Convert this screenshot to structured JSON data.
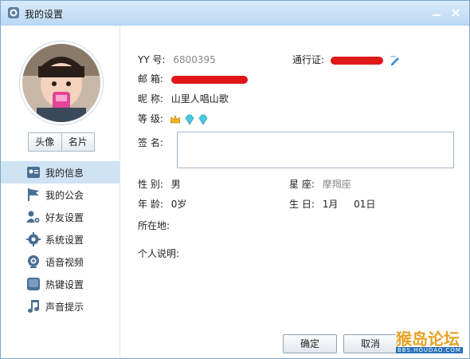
{
  "window": {
    "title": "我的设置"
  },
  "sidebar": {
    "avatar_buttons": [
      "头像",
      "名片"
    ],
    "items": [
      {
        "label": "我的信息",
        "icon": "profile-card-icon",
        "active": true
      },
      {
        "label": "我的公会",
        "icon": "flag-icon",
        "active": false
      },
      {
        "label": "好友设置",
        "icon": "friend-settings-icon",
        "active": false
      },
      {
        "label": "系统设置",
        "icon": "gear-icon",
        "active": false
      },
      {
        "label": "语音视频",
        "icon": "webcam-icon",
        "active": false
      },
      {
        "label": "热键设置",
        "icon": "hotkey-icon",
        "active": false
      },
      {
        "label": "声音提示",
        "icon": "music-note-icon",
        "active": false
      }
    ]
  },
  "profile": {
    "yy_label": "YY 号:",
    "yy_value": "6800395",
    "pass_label": "通行证:",
    "email_label": "邮 箱:",
    "nickname_label": "昵 称:",
    "nickname_value": "山里人唱山歌",
    "level_label": "等 级:",
    "signature_label": "签 名:",
    "signature_value": "",
    "gender_label": "性 别:",
    "gender_value": "男",
    "zodiac_label": "星 座:",
    "zodiac_value": "摩羯座",
    "age_label": "年 龄:",
    "age_value": "0岁",
    "birthday_label": "生 日:",
    "birthday_month": "1月",
    "birthday_day": "01日",
    "location_label": "所在地:",
    "location_value": "",
    "bio_label": "个人说明:",
    "bio_value": ""
  },
  "footer": {
    "ok_label": "确定",
    "cancel_label": "取消"
  },
  "watermark": {
    "big": "猴岛论坛",
    "small": "BBS.HOUDAO.COM"
  },
  "colors": {
    "accent": "#cfe3f5",
    "title_gradient_top": "#d9ebfa",
    "redaction": "#e01818"
  }
}
